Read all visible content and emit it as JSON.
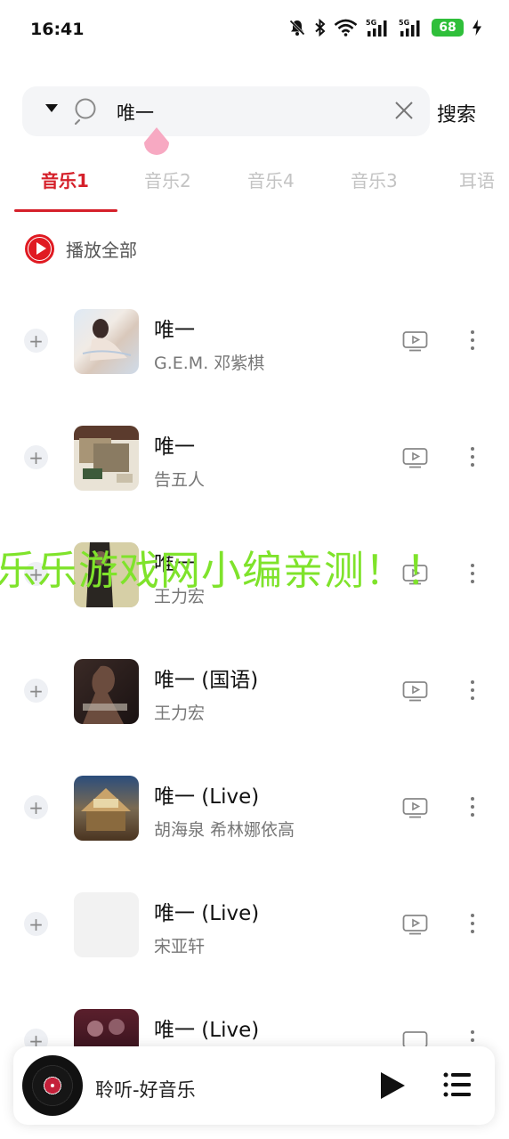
{
  "status_bar": {
    "time": "16:41",
    "battery": "68"
  },
  "search": {
    "query": "唯一",
    "button": "搜索"
  },
  "tabs": [
    "音乐1",
    "音乐2",
    "音乐4",
    "音乐3",
    "耳语"
  ],
  "play_all": "播放全部",
  "songs": [
    {
      "title": "唯一",
      "artist": "G.E.M. 邓紫棋"
    },
    {
      "title": "唯一",
      "artist": "告五人"
    },
    {
      "title": "唯一",
      "artist": "王力宏"
    },
    {
      "title": "唯一 (国语)",
      "artist": "王力宏"
    },
    {
      "title": "唯一 (Live)",
      "artist": "胡海泉 希林娜依高"
    },
    {
      "title": "唯一 (Live)",
      "artist": "宋亚轩"
    },
    {
      "title": "唯一 (Live)",
      "artist": ""
    }
  ],
  "watermark": "乐乐游戏网小编亲测！！",
  "player": {
    "title": "聆听-好音乐"
  },
  "colors": {
    "accent": "#d5202a",
    "watermark": "#7fe32b",
    "battery": "#2fbf3a"
  }
}
